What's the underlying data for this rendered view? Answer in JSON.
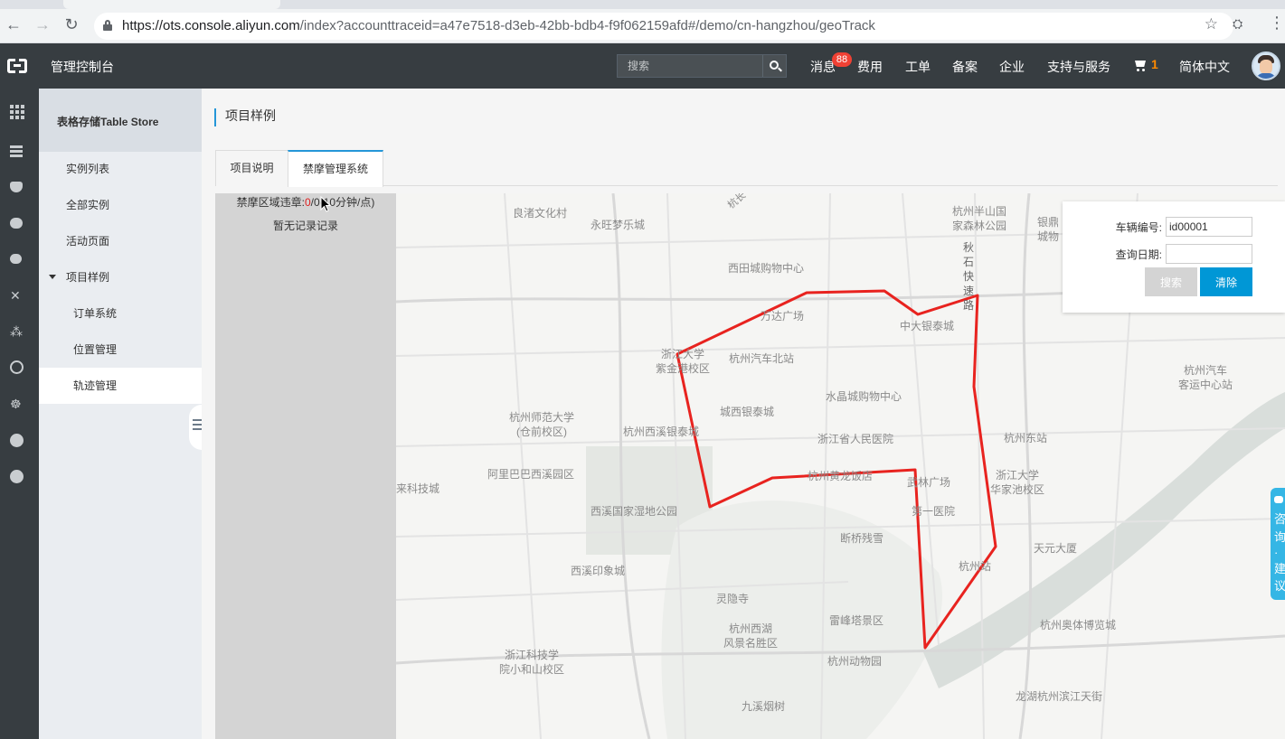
{
  "browser": {
    "url_host": "https://ots.console.aliyun.com",
    "url_path": "/index?accounttraceid=a47e7518-d3eb-42bb-bdb4-f9f062159afd#/demo/cn-hangzhou/geoTrack"
  },
  "header": {
    "title": "管理控制台",
    "search_placeholder": "搜索",
    "nav": [
      "消息",
      "费用",
      "工单",
      "备案",
      "企业",
      "支持与服务"
    ],
    "message_badge": "88",
    "cart_count": "1",
    "language": "简体中文"
  },
  "sidebar": {
    "title": "表格存储Table Store",
    "items": [
      {
        "label": "实例列表"
      },
      {
        "label": "全部实例"
      },
      {
        "label": "活动页面"
      },
      {
        "label": "项目样例"
      },
      {
        "label": "订单系统"
      },
      {
        "label": "位置管理"
      },
      {
        "label": "轨迹管理"
      }
    ]
  },
  "page": {
    "heading": "项目样例",
    "tabs": [
      "项目说明",
      "禁摩管理系统"
    ]
  },
  "records": {
    "prefix": "禁摩区域违章:",
    "violations": "0",
    "rest": "/0(10分钟/点)",
    "empty": "暂无记录记录"
  },
  "query": {
    "vehicle_label": "车辆编号:",
    "vehicle_value": "id00001",
    "date_label": "查询日期:",
    "date_value": "",
    "search_button": "搜索",
    "clear_button": "清除"
  },
  "consult": {
    "chars": [
      "咨",
      "询",
      "·",
      "建",
      "议"
    ]
  },
  "map": {
    "route_color": "#e8231f",
    "labels": [
      "良渚文化村",
      "永旺梦乐城",
      "西田城购物中心",
      "杭州半山国\n家森林公园",
      "银鼎\n城物",
      "秋\n石\n快\n速\n路",
      "万达广场",
      "中大银泰城",
      "浙江大学\n紫金港校区",
      "杭州汽车北站",
      "杭州汽车\n客运中心站",
      "水晶城购物中心",
      "杭州师范大学\n(仓前校区)",
      "城西银泰城",
      "杭州西溪银泰城",
      "浙江省人民医院",
      "杭州东站",
      "阿里巴巴西溪园区",
      "杭州黄龙饭店",
      "武林广场",
      "浙江大学\n华家池校区",
      "来科技城",
      "西溪国家湿地公园",
      "第一医院",
      "断桥残雪",
      "天元大厦",
      "西溪印象城",
      "杭州站",
      "灵隐寺",
      "杭州西湖\n风景名胜区",
      "雷峰塔景区",
      "杭州奥体博览城",
      "浙江科技学\n院小和山校区",
      "杭州动物园",
      "九溪烟树",
      "龙湖杭州滨江天街",
      "杭长"
    ]
  }
}
